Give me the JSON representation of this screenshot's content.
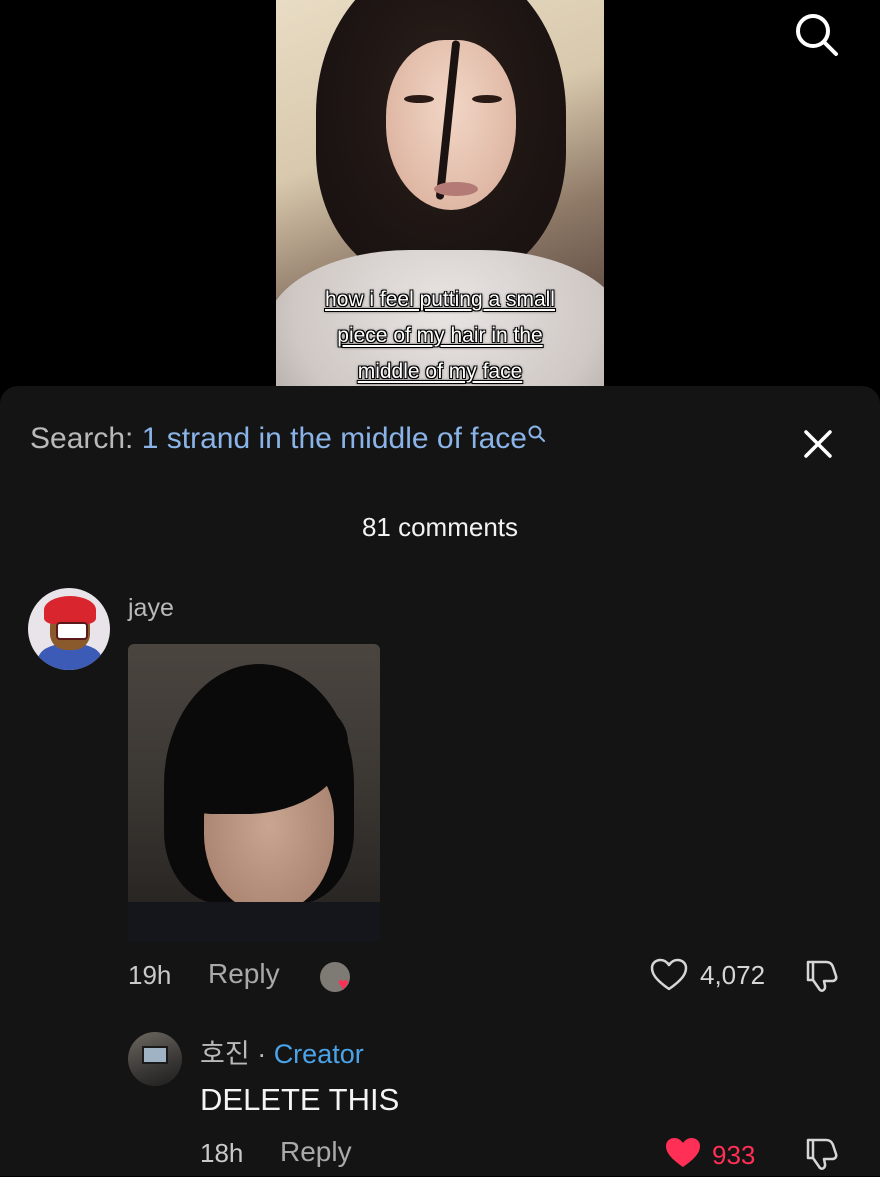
{
  "video": {
    "caption_lines": [
      "how i feel putting a small",
      "piece of my hair in the",
      "middle of my face"
    ]
  },
  "header": {
    "search_icon": "search-icon"
  },
  "sheet": {
    "search_label": "Search:",
    "search_query": "1 strand in the middle of face",
    "close_icon": "close-icon",
    "comment_count": "81 comments"
  },
  "comments": [
    {
      "username": "jaye",
      "has_photo": true,
      "time": "19h",
      "reply_label": "Reply",
      "creator_liked": true,
      "likes": "4,072",
      "liked": false
    }
  ],
  "replies": [
    {
      "username": "호진",
      "separator": " · ",
      "badge": "Creator",
      "text": "DELETE THIS",
      "time": "18h",
      "reply_label": "Reply",
      "likes": "933",
      "liked": true
    }
  ],
  "colors": {
    "background": "#000000",
    "sheet": "#141414",
    "accent_blue": "#8ab4e8",
    "creator_blue": "#4aa3e8",
    "like_red": "#ff2f55"
  }
}
